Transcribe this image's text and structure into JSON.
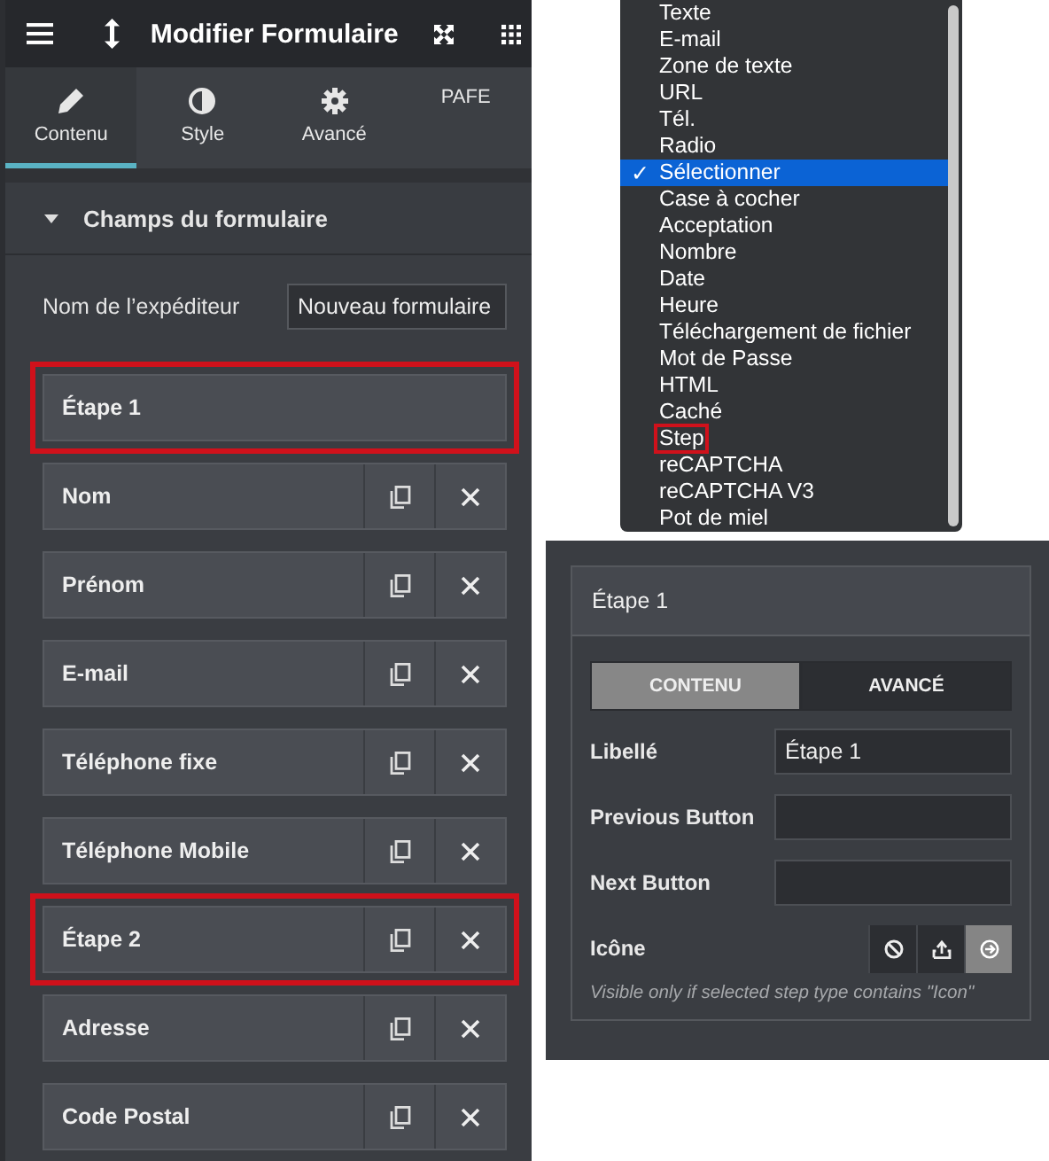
{
  "editor": {
    "title": "Modifier Formulaire",
    "tabs": [
      {
        "label": "Contenu",
        "selected": true
      },
      {
        "label": "Style",
        "selected": false
      },
      {
        "label": "Avancé",
        "selected": false
      },
      {
        "label": "PAFE",
        "selected": false
      }
    ],
    "section": {
      "title": "Champs du formulaire",
      "expanded": true
    },
    "sender": {
      "label": "Nom de l’expéditeur",
      "value": "Nouveau formulaire"
    },
    "fields": [
      {
        "label": "Étape 1",
        "actions": false,
        "highlighted": true
      },
      {
        "label": "Nom",
        "actions": true,
        "highlighted": false
      },
      {
        "label": "Prénom",
        "actions": true,
        "highlighted": false
      },
      {
        "label": "E-mail",
        "actions": true,
        "highlighted": false
      },
      {
        "label": "Téléphone fixe",
        "actions": true,
        "highlighted": false
      },
      {
        "label": "Téléphone Mobile",
        "actions": true,
        "highlighted": false
      },
      {
        "label": "Étape 2",
        "actions": true,
        "highlighted": true
      },
      {
        "label": "Adresse",
        "actions": true,
        "highlighted": false
      },
      {
        "label": "Code Postal",
        "actions": true,
        "highlighted": false
      }
    ]
  },
  "dropdown": {
    "options": [
      {
        "label": "Texte",
        "selected": false,
        "highlighted": false
      },
      {
        "label": "E-mail",
        "selected": false,
        "highlighted": false
      },
      {
        "label": "Zone de texte",
        "selected": false,
        "highlighted": false
      },
      {
        "label": "URL",
        "selected": false,
        "highlighted": false
      },
      {
        "label": "Tél.",
        "selected": false,
        "highlighted": false
      },
      {
        "label": "Radio",
        "selected": false,
        "highlighted": false
      },
      {
        "label": "Sélectionner",
        "selected": true,
        "highlighted": false
      },
      {
        "label": "Case à cocher",
        "selected": false,
        "highlighted": false
      },
      {
        "label": "Acceptation",
        "selected": false,
        "highlighted": false
      },
      {
        "label": "Nombre",
        "selected": false,
        "highlighted": false
      },
      {
        "label": "Date",
        "selected": false,
        "highlighted": false
      },
      {
        "label": "Heure",
        "selected": false,
        "highlighted": false
      },
      {
        "label": "Téléchargement de fichier",
        "selected": false,
        "highlighted": false
      },
      {
        "label": "Mot de Passe",
        "selected": false,
        "highlighted": false
      },
      {
        "label": "HTML",
        "selected": false,
        "highlighted": false
      },
      {
        "label": "Caché",
        "selected": false,
        "highlighted": false
      },
      {
        "label": "Step",
        "selected": false,
        "highlighted": true
      },
      {
        "label": "reCAPTCHA",
        "selected": false,
        "highlighted": false
      },
      {
        "label": "reCAPTCHA V3",
        "selected": false,
        "highlighted": false
      },
      {
        "label": "Pot de miel",
        "selected": false,
        "highlighted": false
      }
    ],
    "check": "✓"
  },
  "step_panel": {
    "title": "Étape 1",
    "tabs": [
      {
        "label": "CONTENU",
        "selected": true
      },
      {
        "label": "AVANCÉ",
        "selected": false
      }
    ],
    "fields": [
      {
        "label": "Libellé",
        "value": "Étape 1"
      },
      {
        "label": "Previous Button"
      },
      {
        "label": "Next Button"
      }
    ],
    "icon_field": {
      "label": "Icône",
      "options": [
        {
          "selected": false
        },
        {
          "selected": false
        },
        {
          "selected": true
        }
      ]
    },
    "hint": "Visible only if selected step type contains \"Icon\""
  }
}
